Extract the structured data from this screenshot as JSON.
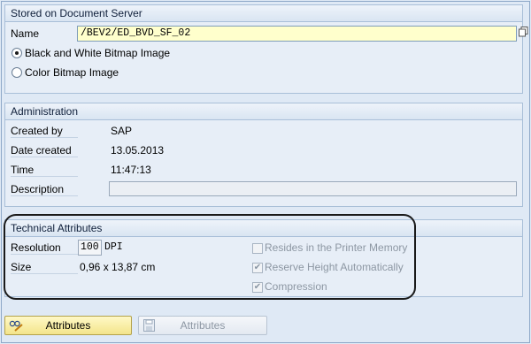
{
  "stored_group": {
    "title": "Stored on Document Server",
    "name_label": "Name",
    "name_value": "/BEV2/ED_BVD_SF_02",
    "radio_bw_label": "Black and White Bitmap Image",
    "radio_color_label": "Color Bitmap Image",
    "selected_radio": "bw"
  },
  "admin_group": {
    "title": "Administration",
    "created_by_label": "Created by",
    "created_by_value": "SAP",
    "date_created_label": "Date created",
    "date_created_value": "13.05.2013",
    "time_label": "Time",
    "time_value": "11:47:13",
    "description_label": "Description",
    "description_value": ""
  },
  "tech_group": {
    "title": "Technical Attributes",
    "resolution_label": "Resolution",
    "resolution_value": "100",
    "resolution_unit": "DPI",
    "size_label": "Size",
    "size_value": "0,96 x 13,87 cm",
    "printer_memory_label": "Resides in the Printer Memory",
    "printer_memory_checked": false,
    "reserve_height_label": "Reserve Height Automatically",
    "reserve_height_checked": true,
    "compression_label": "Compression",
    "compression_checked": true
  },
  "buttons": {
    "attributes_label": "Attributes",
    "attributes_disabled_label": "Attributes"
  }
}
